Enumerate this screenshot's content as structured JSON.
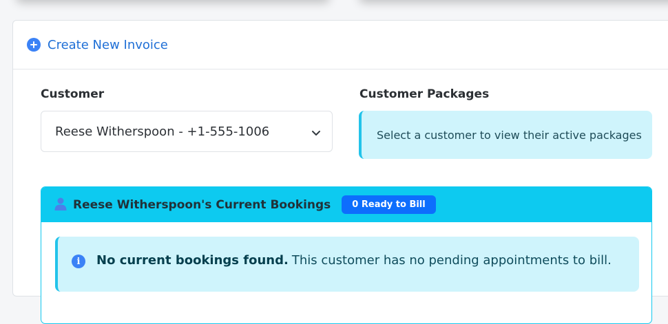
{
  "header": {
    "title": "Create New Invoice",
    "icon": "plus-circle-icon",
    "accent_color": "#1f6fd6"
  },
  "customer": {
    "label": "Customer",
    "selected_value": "Reese Witherspoon - +1-555-1006"
  },
  "packages": {
    "label": "Customer Packages",
    "message": "Select a customer to view their active packages"
  },
  "bookings": {
    "title": "Reese Witherspoon's Current Bookings",
    "badge": "0 Ready to Bill",
    "alert_strong": "No current bookings found.",
    "alert_text": "This customer has no pending appointments to bill."
  }
}
